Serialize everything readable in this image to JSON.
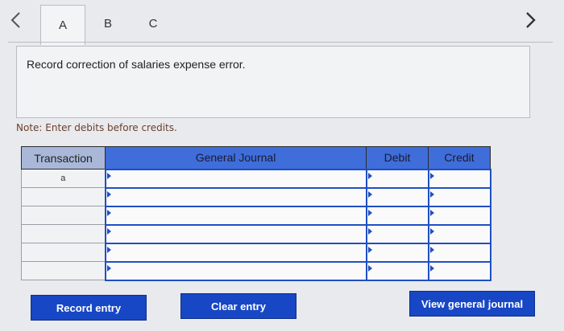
{
  "tabs": [
    {
      "label": "A",
      "active": true
    },
    {
      "label": "B",
      "active": false
    },
    {
      "label": "C",
      "active": false
    }
  ],
  "instruction": "Record correction of salaries expense error.",
  "note": "Note: Enter debits before credits.",
  "journal": {
    "headers": {
      "transaction": "Transaction",
      "general_journal": "General Journal",
      "debit": "Debit",
      "credit": "Credit"
    },
    "rows": [
      {
        "transaction": "a",
        "account": "",
        "debit": "",
        "credit": ""
      },
      {
        "transaction": "",
        "account": "",
        "debit": "",
        "credit": ""
      },
      {
        "transaction": "",
        "account": "",
        "debit": "",
        "credit": ""
      },
      {
        "transaction": "",
        "account": "",
        "debit": "",
        "credit": ""
      },
      {
        "transaction": "",
        "account": "",
        "debit": "",
        "credit": ""
      },
      {
        "transaction": "",
        "account": "",
        "debit": "",
        "credit": ""
      }
    ]
  },
  "buttons": {
    "record": "Record entry",
    "clear": "Clear entry",
    "view": "View general journal"
  },
  "icons": {
    "prev": "chevron-left-icon",
    "next": "chevron-right-icon"
  },
  "colors": {
    "accent": "#1747c4",
    "header": "#3f6edb"
  }
}
